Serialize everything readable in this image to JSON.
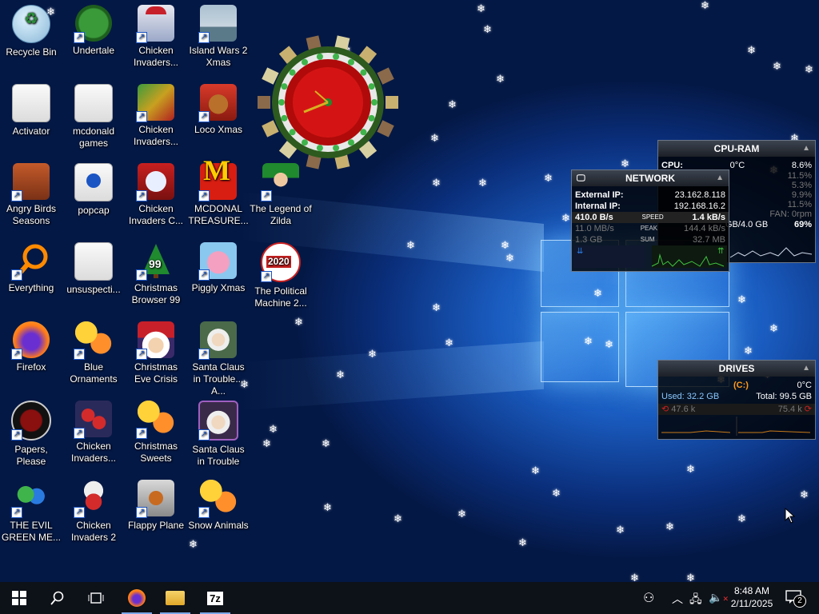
{
  "desktop": {
    "icons": [
      {
        "label": "Recycle Bin"
      },
      {
        "label": "Undertale"
      },
      {
        "label": "Chicken Invaders..."
      },
      {
        "label": "Island Wars 2 Xmas"
      },
      {
        "label": "Activator"
      },
      {
        "label": "mcdonald games"
      },
      {
        "label": "Chicken Invaders..."
      },
      {
        "label": "Loco Xmas"
      },
      {
        "label": "Angry Birds Seasons"
      },
      {
        "label": "popcap"
      },
      {
        "label": "Chicken Invaders C..."
      },
      {
        "label": "MCDONAL TREASURE..."
      },
      {
        "label": "The Legend of Zilda"
      },
      {
        "label": "Everything"
      },
      {
        "label": "unsuspecti..."
      },
      {
        "label": "Christmas Browser 99"
      },
      {
        "label": "Piggly Xmas"
      },
      {
        "label": "The Political Machine 2..."
      },
      {
        "label": "Firefox"
      },
      {
        "label": "Blue Ornaments"
      },
      {
        "label": "Christmas Eve Crisis"
      },
      {
        "label": "Santa Claus in Trouble... A..."
      },
      {
        "label": "Papers, Please"
      },
      {
        "label": "Chicken Invaders..."
      },
      {
        "label": "Christmas Sweets"
      },
      {
        "label": "Santa Claus in Trouble"
      },
      {
        "label": "THE EVIL GREEN ME..."
      },
      {
        "label": "Chicken Invaders 2"
      },
      {
        "label": "Flappy Plane"
      },
      {
        "label": "Snow Animals"
      }
    ]
  },
  "icon_text": {
    "christmas_browser": "99",
    "political_machine": "2020"
  },
  "cpu_ram": {
    "title": "CPU-RAM",
    "cpu_label": "CPU:",
    "cpu_temp": "0°C",
    "cpu_total": "8.6%",
    "cores": [
      "11.5%",
      "5.3%",
      "9.9%",
      "11.5%"
    ],
    "fan": "FAN: 0rpm",
    "ram": "GB/4.0 GB",
    "ram_pct": "69%"
  },
  "network": {
    "title": "NETWORK",
    "external_ip_label": "External IP:",
    "external_ip": "23.162.8.118",
    "internal_ip_label": "Internal IP:",
    "internal_ip": "192.168.16.2",
    "down_speed": "410.0 B/s",
    "speed_label": "SPEED",
    "up_speed": "1.4 kB/s",
    "down_peak": "11.0 MB/s",
    "peak_label": "PEAK",
    "up_peak": "144.4 kB/s",
    "down_sum": "1.3 GB",
    "sum_label": "SUM",
    "up_sum": "32.7 MB"
  },
  "drives": {
    "title": "DRIVES",
    "drive_letter": "(C:)",
    "temp": "0°C",
    "used": "Used: 32.2 GB",
    "total": "Total: 99.5 GB",
    "read": "47.6 k",
    "write": "75.4 k"
  },
  "taskbar": {
    "apps": [
      "start",
      "search",
      "task-view",
      "firefox",
      "file-explorer",
      "7zip"
    ],
    "zip_label": "7z",
    "time": "8:48 AM",
    "date": "2/11/2025",
    "notifications": "2"
  },
  "colors": {
    "accent": "#1b55c4",
    "firefox": "#ff7a1a",
    "mcdonalds": "#ffcc00"
  }
}
